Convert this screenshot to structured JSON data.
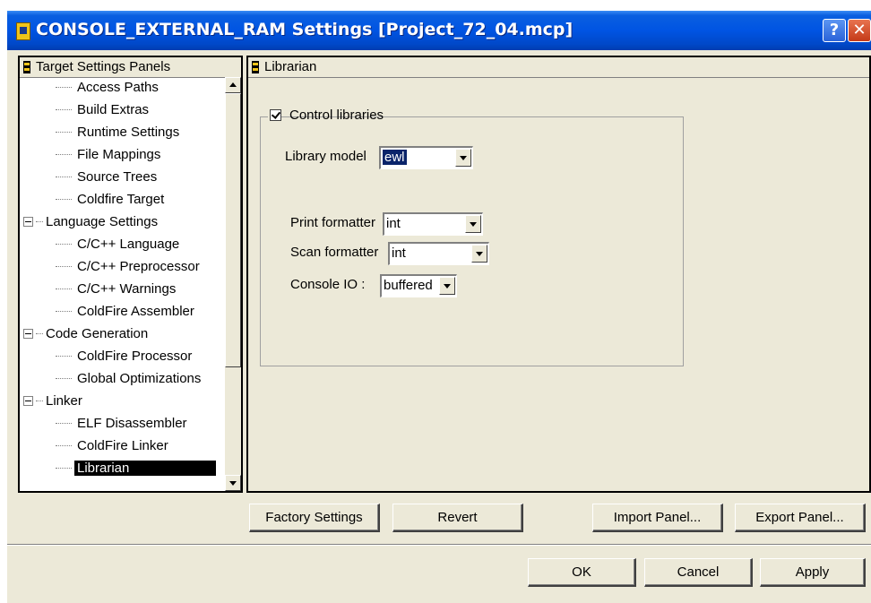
{
  "window": {
    "title": "CONSOLE_EXTERNAL_RAM Settings [Project_72_04.mcp]",
    "help_label": "?",
    "close_label": "✕"
  },
  "left_panel": {
    "header": "Target Settings Panels",
    "tree": [
      {
        "label": "Access Paths",
        "level": 1
      },
      {
        "label": "Build Extras",
        "level": 1
      },
      {
        "label": "Runtime Settings",
        "level": 1
      },
      {
        "label": "File Mappings",
        "level": 1
      },
      {
        "label": "Source Trees",
        "level": 1
      },
      {
        "label": "Coldfire Target",
        "level": 1
      },
      {
        "label": "Language Settings",
        "level": 0
      },
      {
        "label": "C/C++ Language",
        "level": 1
      },
      {
        "label": "C/C++ Preprocessor",
        "level": 1
      },
      {
        "label": "C/C++ Warnings",
        "level": 1
      },
      {
        "label": "ColdFire Assembler",
        "level": 1
      },
      {
        "label": "Code Generation",
        "level": 0
      },
      {
        "label": "ColdFire Processor",
        "level": 1
      },
      {
        "label": "Global Optimizations",
        "level": 1
      },
      {
        "label": "Linker",
        "level": 0
      },
      {
        "label": "ELF Disassembler",
        "level": 1
      },
      {
        "label": "ColdFire Linker",
        "level": 1
      },
      {
        "label": "Librarian",
        "level": 1,
        "selected": true
      }
    ]
  },
  "right_panel": {
    "header": "Librarian",
    "control_libraries": {
      "label": "Control libraries",
      "checked": true
    },
    "library_model": {
      "label": "Library model",
      "value": "ewl"
    },
    "print_formatter": {
      "label": "Print formatter",
      "value": "int"
    },
    "scan_formatter": {
      "label": "Scan formatter",
      "value": "int"
    },
    "console_io": {
      "label": "Console IO :",
      "value": "buffered"
    }
  },
  "panel_buttons": {
    "factory": "Factory Settings",
    "revert": "Revert",
    "import": "Import Panel...",
    "export": "Export Panel..."
  },
  "dialog_buttons": {
    "ok": "OK",
    "cancel": "Cancel",
    "apply": "Apply"
  },
  "colors": {
    "titlebar": "#0054e3",
    "dialog_bg": "#ece9d8",
    "selection": "#000000",
    "highlight": "#0a246a"
  }
}
